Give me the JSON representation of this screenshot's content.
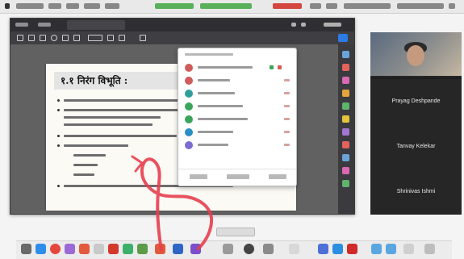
{
  "page_heading": "१.१ निरंग विभूति :",
  "app": {
    "tabs": [],
    "share_label": ""
  },
  "participants": [
    {
      "name": "Prayag Deshpande"
    },
    {
      "name": "Tanvay Kelekar"
    },
    {
      "name": "Shrinivas Ishmi"
    }
  ],
  "colors": {
    "accent": "#2c7be5",
    "annotation": "#e63f4f",
    "participant_bg": "#1e1e1e"
  },
  "icons": [
    "apple-icon",
    "wifi-icon",
    "battery-icon",
    "search-icon",
    "share-icon",
    "participants-icon",
    "chat-icon"
  ]
}
